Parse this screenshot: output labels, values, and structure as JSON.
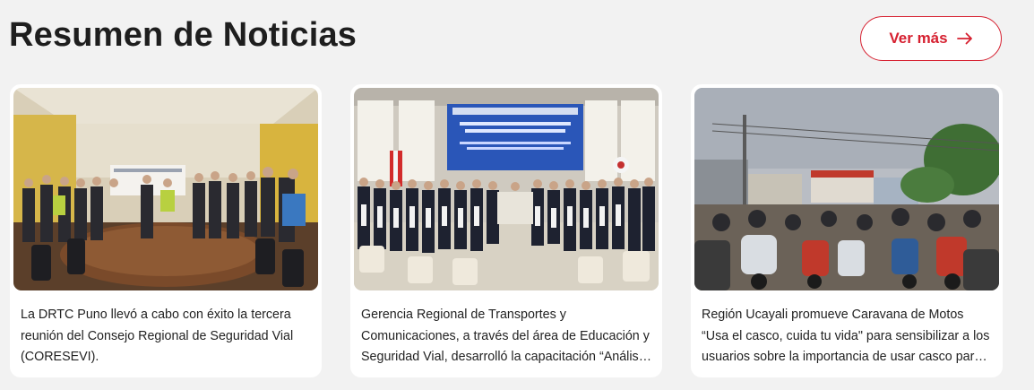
{
  "section": {
    "title": "Resumen de Noticias",
    "ver_mas_label": "Ver más"
  },
  "news": [
    {
      "text": "La DRTC Puno llevó a cabo con éxito la tercera reunión del Consejo Regional de Seguridad Vial (CORESEVI)."
    },
    {
      "text": "Gerencia Regional de Transportes y Comunicaciones, a través del área de Educación y Seguridad Vial, desarrolló la capacitación “Análisis de Datos de Siniestralidad Vial con Estrategias Geoespaciales”."
    },
    {
      "text": "Región Ucayali promueve Caravana de Motos “Usa el casco, cuida tu vida\" para sensibilizar a los usuarios sobre la importancia de usar casco para prevenir accidentes."
    }
  ],
  "colors": {
    "accent": "#d62030",
    "card_bg": "#ffffff",
    "page_bg": "#f2f2f2"
  },
  "icons": {
    "ver_mas": "arrow-right-icon"
  }
}
